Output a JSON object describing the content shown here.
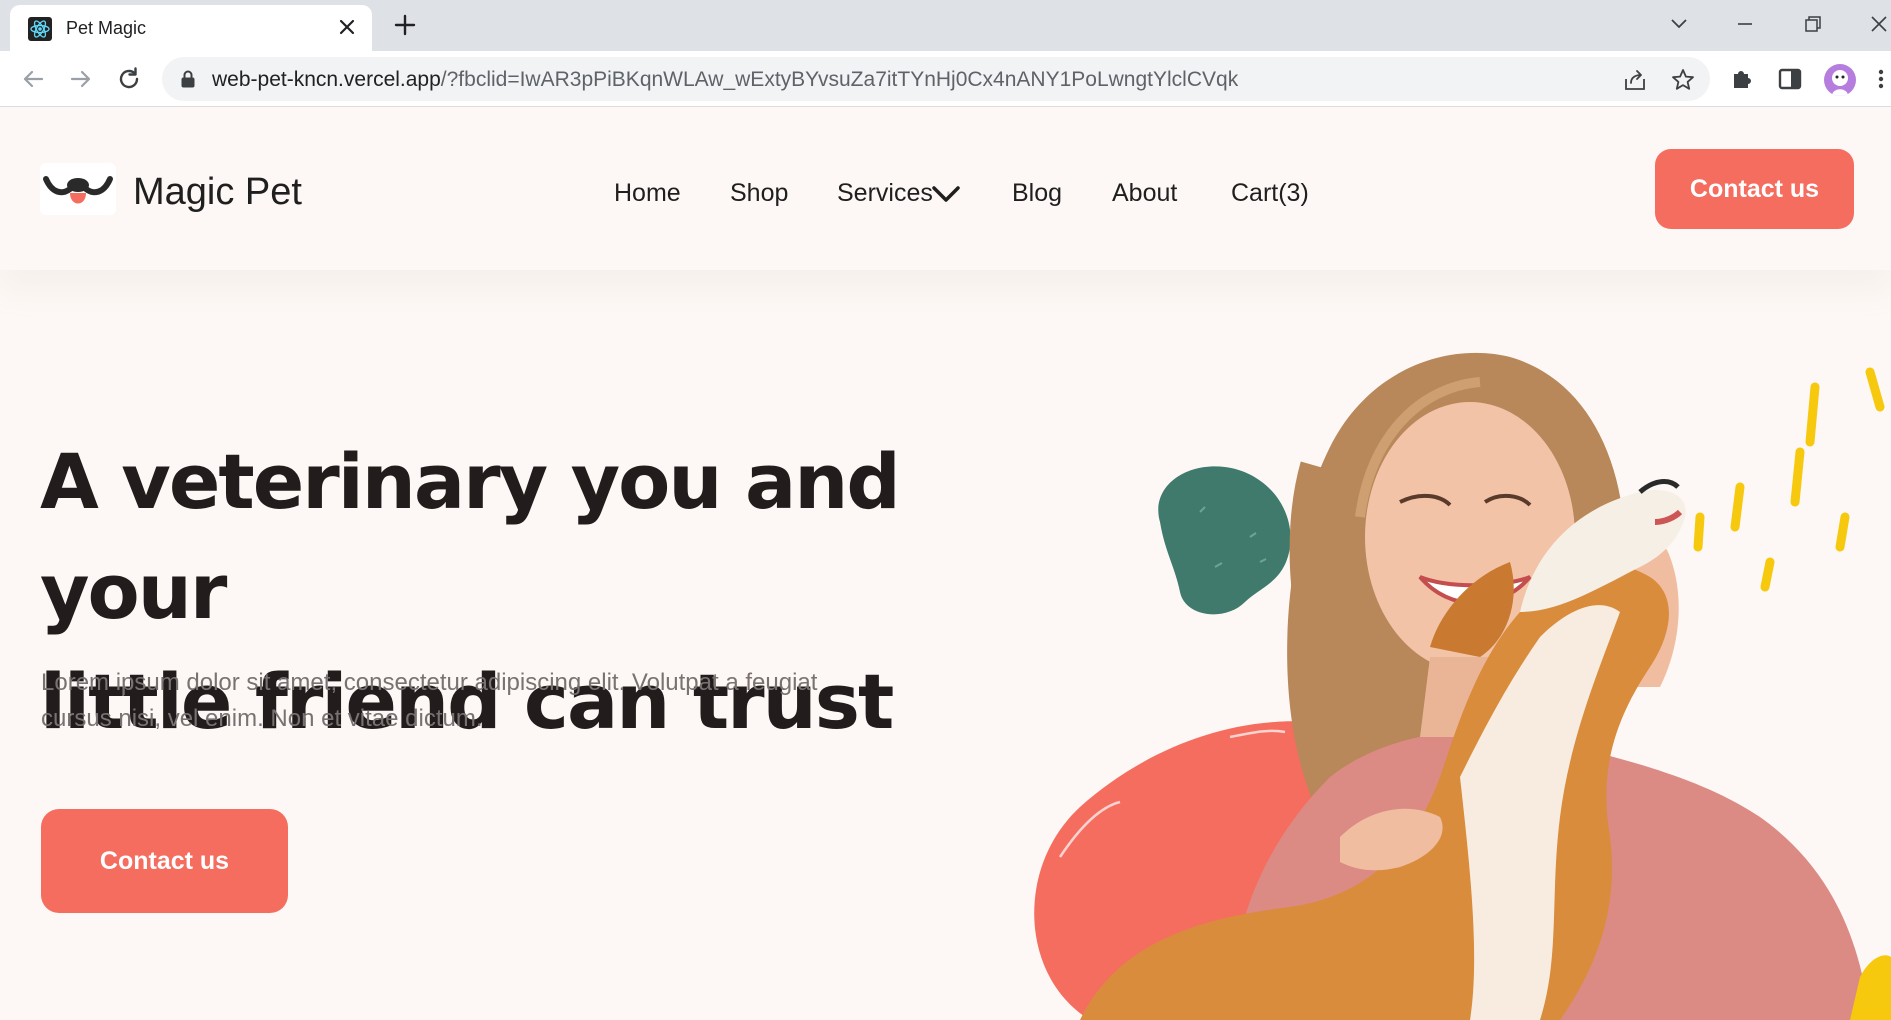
{
  "browser": {
    "tab_title": "Pet Magic",
    "url_host": "web-pet-kncn.vercel.app",
    "url_path": "/?fbclid=IwAR3pPiBKqnWLAw_wExtyBYvsuZa7itTYnHj0Cx4nANY1PoLwngtYlclCVqk"
  },
  "header": {
    "logo_text": "Magic Pet",
    "nav": [
      {
        "label": "Home"
      },
      {
        "label": "Shop"
      },
      {
        "label": "Services"
      },
      {
        "label": "Blog"
      },
      {
        "label": "About"
      },
      {
        "label": "Cart(3)"
      }
    ],
    "contact_label": "Contact us"
  },
  "hero": {
    "title_line1": "A veterinary you and your",
    "title_line2": "little friend can trust",
    "description_line1": "Lorem ipsum dolor sit amet, consectetur adipiscing elit. Volutpat a feugiat",
    "description_line2": "cursus nisi, vel enim. Non et vitae dictum.",
    "cta_label": "Contact us"
  },
  "colors": {
    "accent": "#f56d5f",
    "background": "#fdf8f5",
    "blob_green": "#3f7a6c",
    "yellow": "#f6c90e"
  }
}
